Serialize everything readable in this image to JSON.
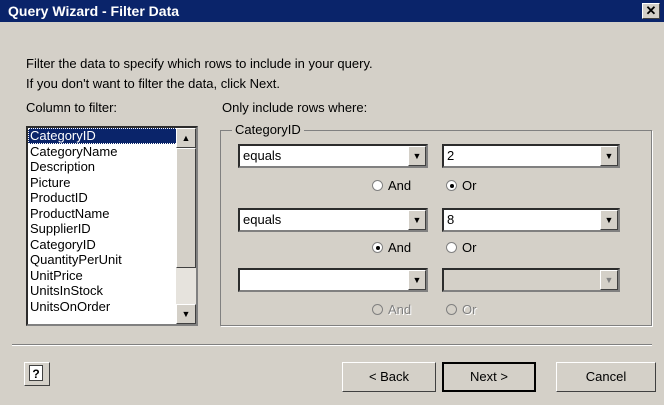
{
  "window": {
    "title": "Query Wizard - Filter Data",
    "close_label": "✕"
  },
  "instructions": {
    "line1": "Filter the data to specify which rows to include in your query.",
    "line2": "If you don't want to filter the data, click Next."
  },
  "column_filter": {
    "label": "Column to filter:",
    "selected": "CategoryID",
    "items": [
      "CategoryID",
      "CategoryName",
      "Description",
      "Picture",
      "ProductID",
      "ProductName",
      "SupplierID",
      "CategoryID",
      "QuantityPerUnit",
      "UnitPrice",
      "UnitsInStock",
      "UnitsOnOrder"
    ]
  },
  "criteria": {
    "label": "Only include rows where:",
    "group_title": "CategoryID",
    "rows": [
      {
        "operator": "equals",
        "value": "2",
        "and_label": "And",
        "or_label": "Or",
        "selected": "Or",
        "enabled": true
      },
      {
        "operator": "equals",
        "value": "8",
        "and_label": "And",
        "or_label": "Or",
        "selected": "And",
        "enabled": true
      },
      {
        "operator": "",
        "value": "",
        "and_label": "And",
        "or_label": "Or",
        "selected": "",
        "enabled": false
      }
    ]
  },
  "buttons": {
    "help_label": "?",
    "back": "< Back",
    "next": "Next >",
    "cancel": "Cancel"
  },
  "icons": {
    "dropdown": "chevron-down-icon",
    "scroll_up": "arrow-up-icon",
    "scroll_down": "arrow-down-icon",
    "help": "help-icon"
  },
  "colors": {
    "title_bar": "#0a246a",
    "selection": "#0a246a",
    "face": "#d4d0c8"
  }
}
